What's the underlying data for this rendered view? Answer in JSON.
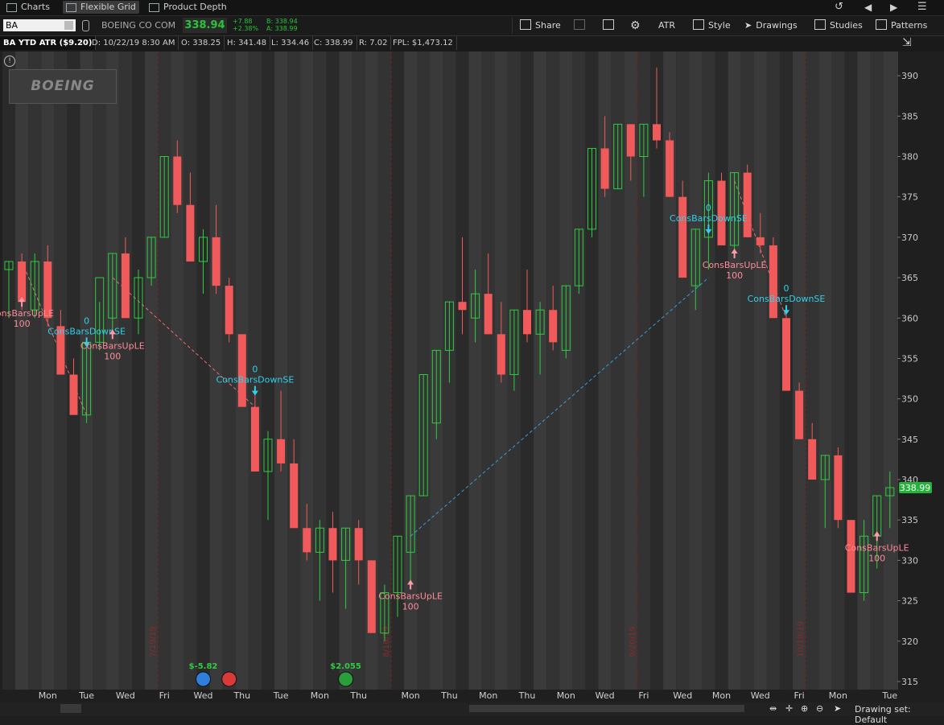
{
  "tabs": [
    {
      "label": "Charts",
      "icon": "chart-icon"
    },
    {
      "label": "Flexible Grid",
      "icon": "grid-icon"
    },
    {
      "label": "Product Depth",
      "icon": "depth-icon"
    }
  ],
  "toolbar": {
    "symbol": "BA",
    "company": "BOEING CO COM",
    "last_price": "338.94",
    "change": "+7.88",
    "change_pct": "+2.38%",
    "bid": "B: 338.94",
    "ask": "A: 338.99",
    "share_label": "Share",
    "atr_label": "ATR",
    "style_label": "Style",
    "drawings_label": "Drawings",
    "studies_label": "Studies",
    "patterns_label": "Patterns"
  },
  "info_bar": {
    "title": "BA YTD ATR ($9.20)",
    "date": "D: 10/22/19 8:30 AM",
    "open": "O: 338.25",
    "high": "H: 341.48",
    "low": "L: 334.46",
    "close": "C: 338.99",
    "range": "R: 7.02",
    "fpl": "FPL: $1,473.12"
  },
  "logo_text": "BOEING",
  "bottom_bar": {
    "drawing_set": "Drawing set: Default"
  },
  "colors": {
    "up": "#2ecc40",
    "down": "#f05a5a",
    "last_price_tag": "#24b33a",
    "background": "#1f1f1f"
  },
  "chart_data": {
    "type": "candlestick",
    "ylim": [
      314,
      393
    ],
    "yticks": [
      315,
      320,
      325,
      330,
      335,
      340,
      345,
      350,
      355,
      360,
      365,
      370,
      375,
      380,
      385,
      390
    ],
    "last_price_label": "338.99",
    "x_day_labels": [
      "Mon",
      "Tue",
      "Wed",
      "Fri",
      "Wed",
      "Thu",
      "Tue",
      "Mon",
      "Thu",
      "Mon",
      "Thu",
      "Mon",
      "Thu",
      "Mon",
      "Wed",
      "Fri",
      "Wed",
      "Mon",
      "Wed",
      "Fri",
      "Mon",
      "Tue"
    ],
    "x_day_label_bars": [
      3,
      6,
      9,
      12,
      15,
      18,
      21,
      24,
      27,
      31,
      34,
      37,
      40,
      43,
      46,
      49,
      52,
      55,
      58,
      61,
      64,
      68
    ],
    "date_markers": [
      {
        "label": "7/19/19",
        "bar": 12
      },
      {
        "label": "8/16/19",
        "bar": 30
      },
      {
        "label": "9/20/19",
        "bar": 49
      },
      {
        "label": "10/18/19",
        "bar": 62
      }
    ],
    "candles": [
      {
        "o": 366,
        "h": 367,
        "l": 360,
        "c": 367
      },
      {
        "o": 367,
        "h": 368,
        "l": 361,
        "c": 362
      },
      {
        "o": 361,
        "h": 368,
        "l": 360,
        "c": 367
      },
      {
        "o": 367,
        "h": 369,
        "l": 359,
        "c": 360
      },
      {
        "o": 359,
        "h": 361,
        "l": 353,
        "c": 353
      },
      {
        "o": 353,
        "h": 355,
        "l": 349,
        "c": 348
      },
      {
        "o": 348,
        "h": 357,
        "l": 347,
        "c": 357
      },
      {
        "o": 357,
        "h": 362,
        "l": 356,
        "c": 365
      },
      {
        "o": 360,
        "h": 368,
        "l": 358,
        "c": 368
      },
      {
        "o": 368,
        "h": 370,
        "l": 360,
        "c": 360
      },
      {
        "o": 360,
        "h": 366,
        "l": 358,
        "c": 365
      },
      {
        "o": 365,
        "h": 370,
        "l": 364,
        "c": 370
      },
      {
        "o": 370,
        "h": 380,
        "l": 370,
        "c": 380
      },
      {
        "o": 380,
        "h": 382,
        "l": 373,
        "c": 374
      },
      {
        "o": 374,
        "h": 378,
        "l": 367,
        "c": 367
      },
      {
        "o": 367,
        "h": 371,
        "l": 363,
        "c": 370
      },
      {
        "o": 370,
        "h": 374,
        "l": 363,
        "c": 364
      },
      {
        "o": 364,
        "h": 365,
        "l": 357,
        "c": 358
      },
      {
        "o": 358,
        "h": 358,
        "l": 349,
        "c": 349
      },
      {
        "o": 349,
        "h": 351,
        "l": 341,
        "c": 341
      },
      {
        "o": 341,
        "h": 346,
        "l": 335,
        "c": 345
      },
      {
        "o": 345,
        "h": 351,
        "l": 341,
        "c": 342
      },
      {
        "o": 342,
        "h": 345,
        "l": 334,
        "c": 334
      },
      {
        "o": 334,
        "h": 337,
        "l": 330,
        "c": 331
      },
      {
        "o": 331,
        "h": 335,
        "l": 325,
        "c": 334
      },
      {
        "o": 334,
        "h": 336,
        "l": 326,
        "c": 330
      },
      {
        "o": 330,
        "h": 334,
        "l": 324,
        "c": 334
      },
      {
        "o": 334,
        "h": 335,
        "l": 327,
        "c": 330
      },
      {
        "o": 330,
        "h": 330,
        "l": 321,
        "c": 321
      },
      {
        "o": 321,
        "h": 327,
        "l": 320,
        "c": 326
      },
      {
        "o": 326,
        "h": 333,
        "l": 323,
        "c": 333
      },
      {
        "o": 331,
        "h": 338,
        "l": 327,
        "c": 338
      },
      {
        "o": 338,
        "h": 353,
        "l": 338,
        "c": 353
      },
      {
        "o": 347,
        "h": 356,
        "l": 345,
        "c": 356
      },
      {
        "o": 356,
        "h": 362,
        "l": 352,
        "c": 362
      },
      {
        "o": 362,
        "h": 370,
        "l": 358,
        "c": 361
      },
      {
        "o": 360,
        "h": 366,
        "l": 357,
        "c": 363
      },
      {
        "o": 363,
        "h": 368,
        "l": 358,
        "c": 358
      },
      {
        "o": 358,
        "h": 362,
        "l": 352,
        "c": 353
      },
      {
        "o": 353,
        "h": 361,
        "l": 351,
        "c": 361
      },
      {
        "o": 361,
        "h": 366,
        "l": 357,
        "c": 358
      },
      {
        "o": 358,
        "h": 362,
        "l": 353,
        "c": 361
      },
      {
        "o": 361,
        "h": 364,
        "l": 356,
        "c": 357
      },
      {
        "o": 356,
        "h": 364,
        "l": 355,
        "c": 364
      },
      {
        "o": 364,
        "h": 371,
        "l": 363,
        "c": 371
      },
      {
        "o": 371,
        "h": 381,
        "l": 370,
        "c": 381
      },
      {
        "o": 381,
        "h": 385,
        "l": 375,
        "c": 376
      },
      {
        "o": 376,
        "h": 384,
        "l": 376,
        "c": 384
      },
      {
        "o": 384,
        "h": 384,
        "l": 377,
        "c": 380
      },
      {
        "o": 380,
        "h": 384,
        "l": 375,
        "c": 384
      },
      {
        "o": 384,
        "h": 391,
        "l": 381,
        "c": 382
      },
      {
        "o": 382,
        "h": 383,
        "l": 375,
        "c": 375
      },
      {
        "o": 375,
        "h": 377,
        "l": 365,
        "c": 365
      },
      {
        "o": 364,
        "h": 371,
        "l": 361,
        "c": 371
      },
      {
        "o": 370,
        "h": 378,
        "l": 366,
        "c": 377
      },
      {
        "o": 377,
        "h": 378,
        "l": 369,
        "c": 369
      },
      {
        "o": 369,
        "h": 378,
        "l": 368,
        "c": 378
      },
      {
        "o": 378,
        "h": 379,
        "l": 370,
        "c": 370
      },
      {
        "o": 370,
        "h": 373,
        "l": 368,
        "c": 369
      },
      {
        "o": 369,
        "h": 370,
        "l": 360,
        "c": 360
      },
      {
        "o": 360,
        "h": 361,
        "l": 351,
        "c": 351
      },
      {
        "o": 351,
        "h": 352,
        "l": 345,
        "c": 345
      },
      {
        "o": 345,
        "h": 347,
        "l": 340,
        "c": 340
      },
      {
        "o": 340,
        "h": 343,
        "l": 334,
        "c": 343
      },
      {
        "o": 343,
        "h": 344,
        "l": 334,
        "c": 335
      },
      {
        "o": 335,
        "h": 335,
        "l": 326,
        "c": 326
      },
      {
        "o": 326,
        "h": 335,
        "l": 325,
        "c": 333
      },
      {
        "o": 333,
        "h": 338,
        "l": 329,
        "c": 338
      },
      {
        "o": 338,
        "h": 341,
        "l": 334,
        "c": 339
      }
    ],
    "signals": [
      {
        "bar": 1,
        "type": "buy",
        "name": "ConsBarsUpLE",
        "qty": "100",
        "at": 362
      },
      {
        "bar": 6,
        "type": "sell",
        "name": "ConsBarsDownSE",
        "qty": "0",
        "at": 357
      },
      {
        "bar": 8,
        "type": "buy",
        "name": "ConsBarsUpLE",
        "qty": "100",
        "at": 358
      },
      {
        "bar": 19,
        "type": "sell",
        "name": "ConsBarsDownSE",
        "qty": "0",
        "at": 351
      },
      {
        "bar": 31,
        "type": "buy",
        "name": "ConsBarsUpLE",
        "qty": "100",
        "at": 327
      },
      {
        "bar": 54,
        "type": "sell",
        "name": "ConsBarsDownSE",
        "qty": "0",
        "at": 371
      },
      {
        "bar": 56,
        "type": "buy",
        "name": "ConsBarsUpLE",
        "qty": "100",
        "at": 368
      },
      {
        "bar": 60,
        "type": "sell",
        "name": "ConsBarsDownSE",
        "qty": "0",
        "at": 361
      },
      {
        "bar": 67,
        "type": "buy",
        "name": "ConsBarsUpLE",
        "qty": "100",
        "at": 333
      }
    ],
    "trade_lines": [
      {
        "from": {
          "bar": 1,
          "y": 367
        },
        "to": {
          "bar": 6,
          "y": 348
        },
        "color": "#f06a6a"
      },
      {
        "from": {
          "bar": 8,
          "y": 365
        },
        "to": {
          "bar": 19,
          "y": 349
        },
        "color": "#f06a6a"
      },
      {
        "from": {
          "bar": 31,
          "y": 333
        },
        "to": {
          "bar": 54,
          "y": 365
        },
        "color": "#3a9ad9"
      },
      {
        "from": {
          "bar": 56,
          "y": 377
        },
        "to": {
          "bar": 60,
          "y": 360
        },
        "color": "#f06a6a"
      }
    ],
    "events": [
      {
        "bar": 15,
        "icon": "dividend-icon",
        "label": "$-5.82",
        "color": "#2f7fd8"
      },
      {
        "bar": 17,
        "icon": "conference-call-icon",
        "label": "",
        "color": "#d83a3a"
      },
      {
        "bar": 26,
        "icon": "earnings-icon",
        "label": "$2.055",
        "color": "#2a9e3a"
      }
    ]
  }
}
